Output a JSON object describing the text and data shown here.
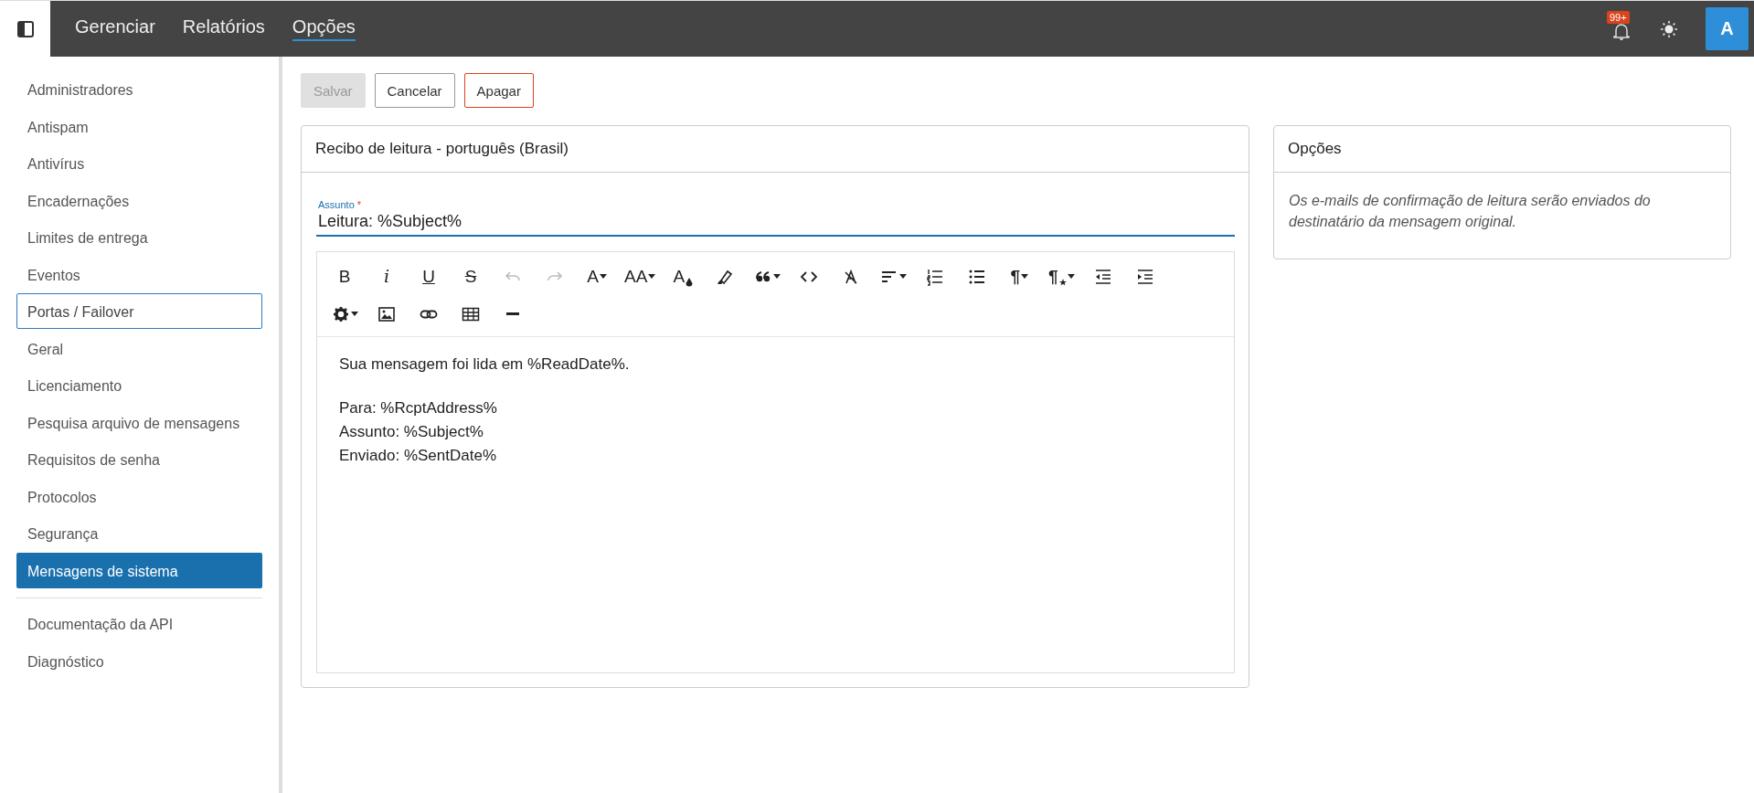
{
  "topbar": {
    "nav": [
      {
        "label": "Gerenciar",
        "selected": false
      },
      {
        "label": "Relatórios",
        "selected": false
      },
      {
        "label": "Opções",
        "selected": true
      }
    ],
    "notification_badge": "99+",
    "avatar": "A"
  },
  "sidebar": {
    "groups": [
      {
        "items": [
          {
            "label": "Administradores",
            "selected": false,
            "focused": false
          },
          {
            "label": "Antispam",
            "selected": false,
            "focused": false
          },
          {
            "label": "Antivírus",
            "selected": false,
            "focused": false
          },
          {
            "label": "Encadernações",
            "selected": false,
            "focused": false
          },
          {
            "label": "Limites de entrega",
            "selected": false,
            "focused": false
          },
          {
            "label": "Eventos",
            "selected": false,
            "focused": false
          },
          {
            "label": "Portas / Failover",
            "selected": false,
            "focused": true
          },
          {
            "label": "Geral",
            "selected": false,
            "focused": false
          },
          {
            "label": "Licenciamento",
            "selected": false,
            "focused": false
          },
          {
            "label": "Pesquisa arquivo de mensagens",
            "selected": false,
            "focused": false
          },
          {
            "label": "Requisitos de senha",
            "selected": false,
            "focused": false
          },
          {
            "label": "Protocolos",
            "selected": false,
            "focused": false
          },
          {
            "label": "Segurança",
            "selected": false,
            "focused": false
          },
          {
            "label": "Mensagens de sistema",
            "selected": true,
            "focused": false
          }
        ]
      },
      {
        "items": [
          {
            "label": "Documentação da API",
            "selected": false,
            "focused": false
          },
          {
            "label": "Diagnóstico",
            "selected": false,
            "focused": false
          }
        ]
      }
    ]
  },
  "actions": [
    {
      "label": "Salvar",
      "kind": "primary",
      "disabled": true
    },
    {
      "label": "Cancelar",
      "kind": "default",
      "disabled": false
    },
    {
      "label": "Apagar",
      "kind": "danger",
      "disabled": false
    }
  ],
  "editor_card": {
    "title": "Recibo de leitura - português (Brasil)",
    "subject": {
      "label": "Assunto",
      "required_marker": "*",
      "value": "Leitura: %Subject%"
    },
    "toolbar": [
      [
        {
          "kind": "bold",
          "glyph": "B",
          "disabled": false,
          "dropdown": false
        },
        {
          "kind": "italic",
          "glyph": "i",
          "disabled": false,
          "dropdown": false
        },
        {
          "kind": "underline",
          "glyph": "U",
          "disabled": false,
          "dropdown": false
        },
        {
          "kind": "strike",
          "glyph": "S",
          "disabled": false,
          "dropdown": false
        },
        {
          "kind": "undo",
          "disabled": true,
          "dropdown": false
        },
        {
          "kind": "redo",
          "disabled": true,
          "dropdown": false
        },
        {
          "kind": "font",
          "glyph": "A",
          "disabled": false,
          "dropdown": true
        },
        {
          "kind": "fontsize",
          "glyph": "AA",
          "disabled": false,
          "dropdown": true
        },
        {
          "kind": "fontcolor",
          "glyph": "A",
          "disabled": false,
          "dropdown": false
        },
        {
          "kind": "highlight",
          "disabled": false,
          "dropdown": false
        },
        {
          "kind": "quote",
          "disabled": false,
          "dropdown": true
        },
        {
          "kind": "code",
          "disabled": false,
          "dropdown": false
        },
        {
          "kind": "clear",
          "disabled": false,
          "dropdown": false
        },
        {
          "kind": "align",
          "disabled": false,
          "dropdown": true
        },
        {
          "kind": "ol",
          "disabled": false,
          "dropdown": false
        },
        {
          "kind": "ul",
          "disabled": false,
          "dropdown": false
        },
        {
          "kind": "paragraph",
          "glyph": "¶",
          "disabled": false,
          "dropdown": true
        },
        {
          "kind": "parastyle",
          "glyph": "¶",
          "disabled": false,
          "dropdown": true
        },
        {
          "kind": "outdent",
          "disabled": false,
          "dropdown": false
        },
        {
          "kind": "indent",
          "disabled": false,
          "dropdown": false
        }
      ],
      [
        {
          "kind": "gear",
          "disabled": false,
          "dropdown": true
        },
        {
          "kind": "image",
          "disabled": false,
          "dropdown": false
        },
        {
          "kind": "link",
          "disabled": false,
          "dropdown": false
        },
        {
          "kind": "table",
          "disabled": false,
          "dropdown": false
        },
        {
          "kind": "hr",
          "disabled": false,
          "dropdown": false
        }
      ]
    ],
    "body": [
      {
        "lines": [
          "Sua mensagem foi lida em %ReadDate%."
        ]
      },
      {
        "lines": [
          "Para: %RcptAddress%",
          "Assunto: %Subject%",
          "Enviado: %SentDate%"
        ]
      }
    ]
  },
  "options_card": {
    "title": "Opções",
    "note": "Os e-mails de confirmação de leitura serão enviados do destinatário da mensagem original."
  }
}
